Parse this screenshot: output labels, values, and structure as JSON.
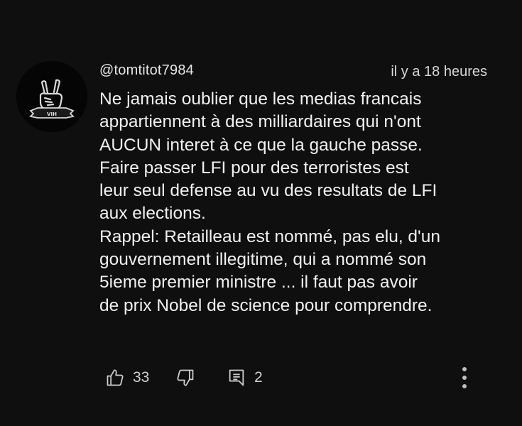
{
  "comment": {
    "author": "@tomtitot7984",
    "time_ago": "il y a 18 heures",
    "text_lines": [
      "Ne jamais oublier que les medias francais",
      "appartiennent à des milliardaires qui n'ont",
      "AUCUN interet à ce que la gauche passe.",
      "Faire passer LFI pour des terroristes est",
      "leur seul defense au vu des resultats de LFI",
      "aux elections.",
      "Rappel: Retailleau est nommé, pas elu, d'un",
      "gouvernement illegitime, qui a nommé son",
      "5ieme premier ministre ... il faut pas avoir",
      "de prix Nobel de science pour comprendre."
    ],
    "avatar_banner_text": "VIH",
    "likes": "33",
    "replies": "2"
  },
  "icons": {
    "like": "thumbs-up-icon",
    "dislike": "thumbs-down-icon",
    "reply": "reply-comment-icon",
    "more": "more-vertical-icon"
  },
  "colors": {
    "background": "#0f0f0f",
    "text": "#f1f1f1",
    "secondary_text": "#d0d0d0"
  }
}
